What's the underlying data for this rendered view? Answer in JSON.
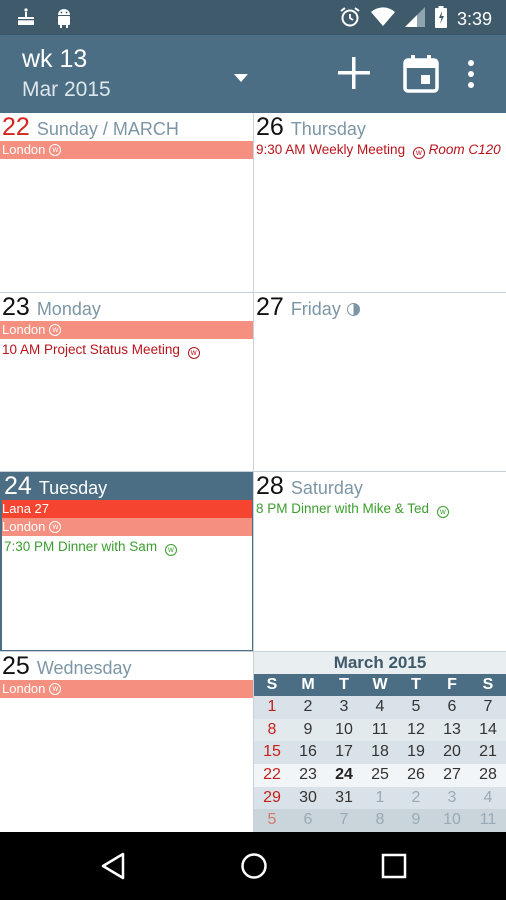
{
  "status_bar": {
    "time": "3:39",
    "left_icons": [
      "cake-icon",
      "android-icon"
    ],
    "right_icons": [
      "alarm-icon",
      "wifi-icon",
      "signal-icon",
      "battery-icon"
    ]
  },
  "app_bar": {
    "week": "wk 13",
    "month": "Mar 2015",
    "actions": [
      "add-icon",
      "calendar-today-icon",
      "overflow-menu-icon"
    ]
  },
  "days": {
    "d22": {
      "num": "22",
      "name": "Sunday / MARCH",
      "allday": [
        {
          "text": "London",
          "color": "#f58f80"
        }
      ],
      "events": []
    },
    "d23": {
      "num": "23",
      "name": "Monday",
      "allday": [
        {
          "text": "London",
          "color": "#f58f80"
        }
      ],
      "events": [
        {
          "text": "10 AM Project Status Meeting",
          "color": "#b8141b"
        }
      ]
    },
    "d24": {
      "num": "24",
      "name": "Tuesday",
      "allday": [
        {
          "text": "Lana 27",
          "color": "#f5442f"
        },
        {
          "text": "London",
          "color": "#f58f80"
        }
      ],
      "events": [
        {
          "text": "7:30 PM Dinner with Sam",
          "color": "#3b9e2e"
        }
      ]
    },
    "d25": {
      "num": "25",
      "name": "Wednesday",
      "allday": [
        {
          "text": "London",
          "color": "#f58f80"
        }
      ],
      "events": []
    },
    "d26": {
      "num": "26",
      "name": "Thursday",
      "allday": [],
      "events": [
        {
          "text": "9:30 AM Weekly Meeting",
          "location": "Room C120",
          "color": "#b8141b"
        }
      ]
    },
    "d27": {
      "num": "27",
      "name": "Friday",
      "allday": [],
      "events": []
    },
    "d28": {
      "num": "28",
      "name": "Saturday",
      "allday": [],
      "events": [
        {
          "text": "8 PM Dinner with Mike & Ted",
          "color": "#3b9e2e"
        }
      ]
    }
  },
  "event_marker": "w",
  "mini_calendar": {
    "title": "March 2015",
    "weekdays": [
      "S",
      "M",
      "T",
      "W",
      "T",
      "F",
      "S"
    ],
    "weeks": [
      [
        "1",
        "2",
        "3",
        "4",
        "5",
        "6",
        "7"
      ],
      [
        "8",
        "9",
        "10",
        "11",
        "12",
        "13",
        "14"
      ],
      [
        "15",
        "16",
        "17",
        "18",
        "19",
        "20",
        "21"
      ],
      [
        "22",
        "23",
        "24",
        "25",
        "26",
        "27",
        "28"
      ],
      [
        "29",
        "30",
        "31",
        "1",
        "2",
        "3",
        "4"
      ],
      [
        "5",
        "6",
        "7",
        "8",
        "9",
        "10",
        "11"
      ]
    ],
    "today": "24"
  },
  "nav_bar": [
    "back-icon",
    "home-icon",
    "recents-icon"
  ],
  "colors": {
    "status_bar": "#3f5a6b",
    "app_bar": "#4c6e84",
    "sunday_red": "#d3241e",
    "allday_salmon": "#f58f80",
    "allday_red": "#f5442f",
    "event_red": "#b8141b",
    "event_green": "#3b9e2e"
  }
}
